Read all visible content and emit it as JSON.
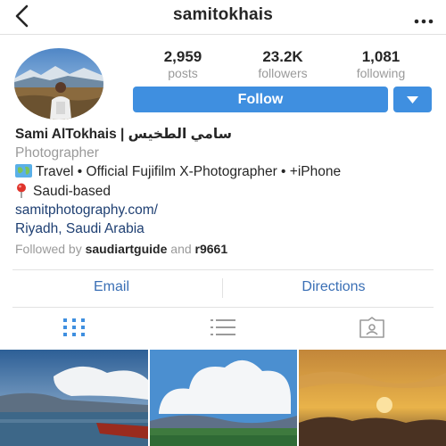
{
  "header": {
    "username": "samitokhais"
  },
  "stats": [
    {
      "value": "2,959",
      "label": "posts"
    },
    {
      "value": "23.2K",
      "label": "followers"
    },
    {
      "value": "1,081",
      "label": "following"
    }
  ],
  "follow": {
    "label": "Follow"
  },
  "bio": {
    "name": "Sami AlTokhais | سامي الطخيس",
    "category": "Photographer",
    "line1": "Travel • Official Fujifilm X-Photographer • +iPhone",
    "line2": "Saudi-based",
    "link": "samitphotography.com/",
    "location": "Riyadh, Saudi Arabia",
    "followed_prefix": "Followed by",
    "followed_user1": "saudiartguide",
    "followed_and": "and",
    "followed_user2": "r9661"
  },
  "actions": {
    "email": "Email",
    "directions": "Directions"
  },
  "colors": {
    "accent": "#3f8fe0",
    "link": "#1e3f72",
    "action": "#3a6fb5",
    "muted": "#9a9a9a"
  },
  "icons": {
    "back": "chevron-left-icon",
    "more": "more-horizontal-icon",
    "dropdown": "chevron-down-icon",
    "grid": "grid-icon",
    "list": "list-icon",
    "tagged": "tagged-icon",
    "map": "world-map-icon",
    "pin": "location-pin-icon"
  }
}
